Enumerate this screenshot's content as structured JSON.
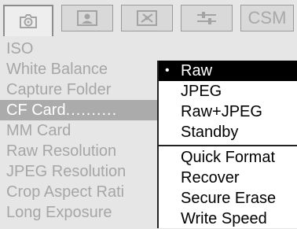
{
  "tabs": [
    {
      "icon": "camera-settings-icon",
      "active": true
    },
    {
      "icon": "portrait-icon",
      "active": false
    },
    {
      "icon": "tools-icon",
      "active": false
    },
    {
      "icon": "sliders-icon",
      "active": false
    },
    {
      "label": "CSM",
      "active": false
    }
  ],
  "menu": {
    "items": [
      {
        "label": "ISO"
      },
      {
        "label": "White Balance"
      },
      {
        "label": "Capture Folder"
      },
      {
        "label": "CF Card",
        "dots": "..........",
        "selected": true
      },
      {
        "label": "MM Card"
      },
      {
        "label": "Raw Resolution"
      },
      {
        "label": "JPEG Resolution"
      },
      {
        "label": "Crop Aspect Rati"
      },
      {
        "label": "Long Exposure"
      }
    ]
  },
  "popup": {
    "bullet": "•",
    "options": [
      {
        "label": "Raw",
        "current": true
      },
      {
        "label": "JPEG"
      },
      {
        "label": "Raw+JPEG"
      },
      {
        "label": "Standby"
      }
    ],
    "actions": [
      {
        "label": "Quick Format"
      },
      {
        "label": "Recover"
      },
      {
        "label": "Secure Erase"
      },
      {
        "label": "Write Speed"
      }
    ]
  },
  "colors": {
    "background": "#e6e6e6",
    "dimmed_text": "#a6a6a6",
    "selection_bg": "#ababab",
    "popup_bg": "#ffffff",
    "popup_highlight": "#000000"
  }
}
